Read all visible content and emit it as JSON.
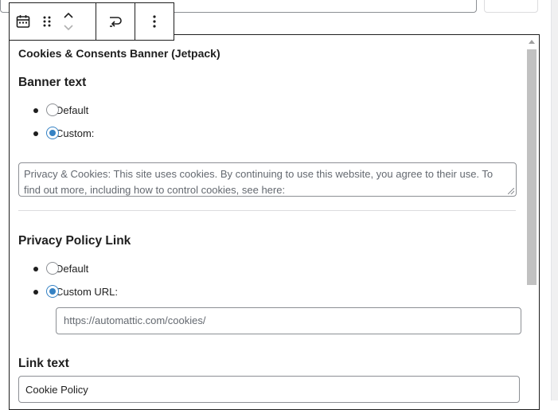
{
  "toolbar": {
    "block_icon": "calendar-icon",
    "drag_icon": "drag-handle-icon",
    "move_up_icon": "chevron-up-icon",
    "move_down_icon": "chevron-down-icon",
    "transform_icon": "link-transform-icon",
    "options_icon": "more-vertical-icon"
  },
  "widget": {
    "title": "Cookies & Consents Banner (Jetpack)",
    "banner_text": {
      "heading": "Banner text",
      "options": [
        {
          "label": "Default",
          "checked": false
        },
        {
          "label": "Custom:",
          "checked": true
        }
      ],
      "custom_text": "Privacy & Cookies: This site uses cookies. By continuing to use this website, you agree to their use. To find out more, including how to control cookies, see here:"
    },
    "privacy_policy": {
      "heading": "Privacy Policy Link",
      "options": [
        {
          "label": "Default",
          "checked": false
        },
        {
          "label": "Custom URL:",
          "checked": true
        }
      ],
      "url_placeholder": "https://automattic.com/cookies/"
    },
    "link_text": {
      "heading": "Link text",
      "value": "Cookie Policy"
    }
  },
  "colors": {
    "accent": "#3582c4",
    "border": "#1e1e1e",
    "input_border": "#8c8f94",
    "scroll_thumb": "#c1c1c1"
  }
}
